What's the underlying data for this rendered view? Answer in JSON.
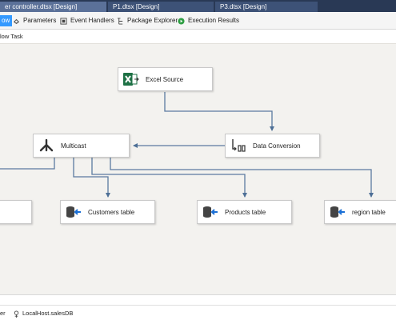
{
  "tabs": [
    {
      "label": "er controller.dtsx [Design]",
      "active": true
    },
    {
      "label": "P1.dtsx [Design]",
      "active": false
    },
    {
      "label": "P3.dtsx [Design]",
      "active": false
    }
  ],
  "toolbar": {
    "items": [
      {
        "label": "ow",
        "icon": "data-flow-icon",
        "active": true
      },
      {
        "label": "Parameters",
        "icon": "parameters-icon"
      },
      {
        "label": "Event Handlers",
        "icon": "event-handlers-icon"
      },
      {
        "label": "Package Explorer",
        "icon": "package-explorer-icon"
      },
      {
        "label": "Execution Results",
        "icon": "execution-results-icon"
      }
    ]
  },
  "breadcrumb": "low Task",
  "nodes": {
    "excel_source": {
      "label": "Excel Source",
      "icon": "excel-source-icon"
    },
    "data_conversion": {
      "label": "Data Conversion",
      "icon": "data-conversion-icon"
    },
    "multicast": {
      "label": "Multicast",
      "icon": "multicast-icon"
    },
    "customers_table": {
      "label": "Customers table",
      "icon": "ole-db-destination-icon"
    },
    "products_table": {
      "label": "Products table",
      "icon": "ole-db-destination-icon"
    },
    "region_table": {
      "label": "region table",
      "icon": "ole-db-destination-icon"
    }
  },
  "connection_managers": {
    "items": [
      {
        "label": "er",
        "icon": ""
      },
      {
        "label": "LocalHost.salesDB",
        "icon": "connection-manager-icon"
      }
    ]
  }
}
